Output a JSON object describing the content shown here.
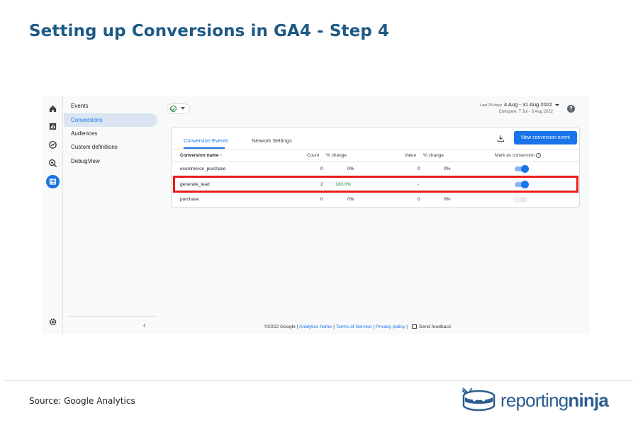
{
  "slide": {
    "title": "Setting up Conversions in GA4 - Step 4",
    "source": "Source: Google Analytics"
  },
  "logo": {
    "part1": "reporting",
    "part2": "ninja"
  },
  "ga": {
    "rail_icons": [
      "home-icon",
      "reports-icon",
      "explore-icon",
      "advertising-icon",
      "configure-icon"
    ],
    "nav": {
      "items": [
        "Events",
        "Conversions",
        "Audiences",
        "Custom definitions",
        "DebugView"
      ],
      "active_index": 1
    },
    "header": {
      "date_prefix": "Last 28 days",
      "date_range": "4 Aug - 31 Aug 2022",
      "compare": "Compare: 7 Jul - 3 Aug 2022",
      "help": "?"
    },
    "card": {
      "tabs": [
        "Conversion Events",
        "Network Settings"
      ],
      "active_tab": 0,
      "new_button": "New conversion event"
    },
    "table": {
      "headers": {
        "name": "Conversion name ↑",
        "count": "Count",
        "count_change": "% change",
        "value": "Value",
        "value_change": "% change",
        "mark": "Mark as conversion"
      },
      "rows": [
        {
          "name": "ecommerce_purchase",
          "count": "0",
          "count_change": "0%",
          "value": "0",
          "value_change": "0%",
          "marked": true
        },
        {
          "name": "generate_lead",
          "count": "2",
          "count_change": "↑ 100.0%",
          "value": "-",
          "value_change": "",
          "marked": true,
          "highlighted": true
        },
        {
          "name": "purchase",
          "count": "0",
          "count_change": "0%",
          "value": "0",
          "value_change": "0%",
          "marked": false
        }
      ]
    },
    "footer": {
      "copyright": "©2022 Google |",
      "links": [
        "Analytics home",
        "Terms of Service",
        "Privacy policy"
      ],
      "separator": "|",
      "feedback": "Send feedback"
    }
  },
  "colors": {
    "title": "#1e5a86",
    "accent": "#1a73e8",
    "highlight": "#e91c1c",
    "positive": "#188038"
  }
}
